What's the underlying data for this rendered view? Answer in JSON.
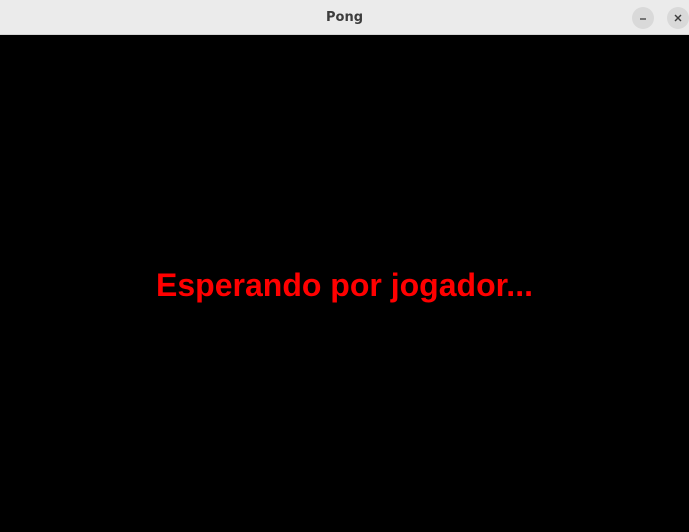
{
  "window": {
    "title": "Pong",
    "controls": {
      "minimize_icon": "minimize-icon",
      "close_icon": "close-icon"
    }
  },
  "game": {
    "background_color": "#000000",
    "status_text": "Esperando por jogador...",
    "status_color": "#ff0000"
  }
}
